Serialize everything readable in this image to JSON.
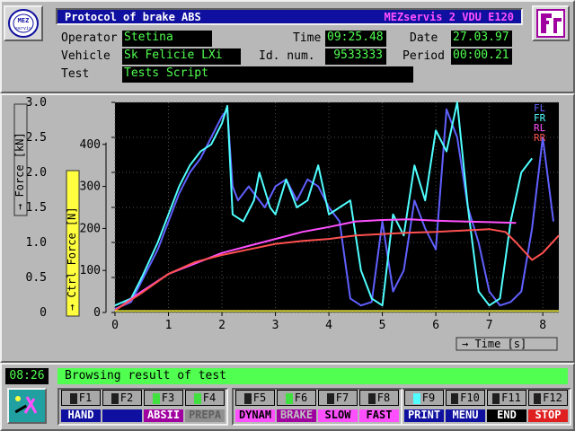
{
  "header": {
    "title": "Protocol of brake ABS",
    "brand": "MEZservis 2 VDU E120",
    "logo_text": "MEZ servis"
  },
  "form": {
    "operator_label": "Operator",
    "operator_value": "Stetina",
    "vehicle_label": "Vehicle",
    "vehicle_value": "Sk Felicie LXi",
    "test_label": "Test",
    "test_value": "Tests Script",
    "time_label": "Time",
    "time_value": "09:25.48",
    "idnum_label": "Id. num.",
    "idnum_value": "9533333",
    "date_label": "Date",
    "date_value": "27.03.97",
    "period_label": "Period",
    "period_value": "00:00.21"
  },
  "chart_data": {
    "type": "line",
    "ylabel": "Force [kN]",
    "ylabel2": "Ctrl Force [N]",
    "xlabel": "Time [s]",
    "xlim": [
      0,
      8.3
    ],
    "ylim": [
      0,
      3.0
    ],
    "y2lim": [
      0,
      500
    ],
    "x_ticks": [
      "0",
      "1",
      "2",
      "3",
      "4",
      "5",
      "6",
      "7",
      "8"
    ],
    "y_ticks": [
      "0",
      "0.5",
      "1.0",
      "1.5",
      "2.0",
      "2.5",
      "3.0"
    ],
    "y2_ticks": [
      "0",
      "100",
      "200",
      "300",
      "400"
    ],
    "grid": true,
    "legend_position": "top-right",
    "series": [
      {
        "name": "FL",
        "color": "#6060ff",
        "points": [
          [
            0,
            0.05
          ],
          [
            0.3,
            0.15
          ],
          [
            0.5,
            0.45
          ],
          [
            0.8,
            0.9
          ],
          [
            1.0,
            1.3
          ],
          [
            1.2,
            1.7
          ],
          [
            1.4,
            2.0
          ],
          [
            1.6,
            2.2
          ],
          [
            1.8,
            2.5
          ],
          [
            2.0,
            2.8
          ],
          [
            2.1,
            2.9
          ],
          [
            2.2,
            1.8
          ],
          [
            2.3,
            1.6
          ],
          [
            2.5,
            1.8
          ],
          [
            2.6,
            1.7
          ],
          [
            2.8,
            1.5
          ],
          [
            3.0,
            1.8
          ],
          [
            3.2,
            1.9
          ],
          [
            3.4,
            1.6
          ],
          [
            3.6,
            1.9
          ],
          [
            3.8,
            1.8
          ],
          [
            4.0,
            1.5
          ],
          [
            4.2,
            1.3
          ],
          [
            4.4,
            0.2
          ],
          [
            4.6,
            0.1
          ],
          [
            4.8,
            0.15
          ],
          [
            5.0,
            1.3
          ],
          [
            5.2,
            0.3
          ],
          [
            5.4,
            0.6
          ],
          [
            5.6,
            1.6
          ],
          [
            5.8,
            1.2
          ],
          [
            6.0,
            0.9
          ],
          [
            6.2,
            2.9
          ],
          [
            6.4,
            2.5
          ],
          [
            6.6,
            1.5
          ],
          [
            6.8,
            1.0
          ],
          [
            7.0,
            0.3
          ],
          [
            7.2,
            0.1
          ],
          [
            7.4,
            0.15
          ],
          [
            7.6,
            0.3
          ],
          [
            7.8,
            1.2
          ],
          [
            8.0,
            2.5
          ],
          [
            8.2,
            1.3
          ]
        ]
      },
      {
        "name": "FR",
        "color": "#50ffff",
        "points": [
          [
            0,
            0.1
          ],
          [
            0.3,
            0.2
          ],
          [
            0.5,
            0.5
          ],
          [
            0.8,
            1.0
          ],
          [
            1.0,
            1.4
          ],
          [
            1.2,
            1.8
          ],
          [
            1.4,
            2.1
          ],
          [
            1.6,
            2.3
          ],
          [
            1.8,
            2.4
          ],
          [
            2.0,
            2.7
          ],
          [
            2.1,
            2.95
          ],
          [
            2.2,
            1.4
          ],
          [
            2.4,
            1.3
          ],
          [
            2.6,
            1.6
          ],
          [
            2.7,
            2.0
          ],
          [
            2.9,
            1.5
          ],
          [
            3.0,
            1.4
          ],
          [
            3.2,
            1.9
          ],
          [
            3.4,
            1.5
          ],
          [
            3.6,
            1.6
          ],
          [
            3.8,
            2.1
          ],
          [
            4.0,
            1.4
          ],
          [
            4.2,
            1.5
          ],
          [
            4.4,
            1.6
          ],
          [
            4.6,
            0.6
          ],
          [
            4.8,
            0.2
          ],
          [
            5.0,
            0.1
          ],
          [
            5.2,
            1.4
          ],
          [
            5.4,
            1.1
          ],
          [
            5.6,
            2.1
          ],
          [
            5.8,
            1.6
          ],
          [
            6.0,
            2.6
          ],
          [
            6.2,
            2.3
          ],
          [
            6.4,
            3.0
          ],
          [
            6.6,
            1.5
          ],
          [
            6.8,
            0.3
          ],
          [
            7.0,
            0.1
          ],
          [
            7.2,
            0.2
          ],
          [
            7.4,
            1.3
          ],
          [
            7.6,
            2.0
          ],
          [
            7.8,
            2.2
          ]
        ]
      },
      {
        "name": "RL",
        "color": "#ff50ff",
        "points": [
          [
            0,
            0.03
          ],
          [
            0.5,
            0.3
          ],
          [
            1.0,
            0.55
          ],
          [
            1.5,
            0.7
          ],
          [
            2.0,
            0.85
          ],
          [
            2.5,
            0.95
          ],
          [
            3.0,
            1.05
          ],
          [
            3.5,
            1.15
          ],
          [
            4.0,
            1.22
          ],
          [
            4.5,
            1.3
          ],
          [
            5.0,
            1.32
          ],
          [
            5.5,
            1.33
          ],
          [
            6.0,
            1.31
          ],
          [
            6.5,
            1.3
          ],
          [
            7.0,
            1.29
          ],
          [
            7.5,
            1.28
          ]
        ]
      },
      {
        "name": "RR",
        "color": "#ff5050",
        "points": [
          [
            0,
            0.03
          ],
          [
            0.5,
            0.28
          ],
          [
            1.0,
            0.55
          ],
          [
            1.5,
            0.72
          ],
          [
            2.0,
            0.82
          ],
          [
            2.5,
            0.9
          ],
          [
            3.0,
            0.98
          ],
          [
            3.5,
            1.02
          ],
          [
            4.0,
            1.05
          ],
          [
            4.5,
            1.1
          ],
          [
            5.0,
            1.12
          ],
          [
            5.5,
            1.14
          ],
          [
            6.0,
            1.15
          ],
          [
            6.5,
            1.17
          ],
          [
            7.0,
            1.19
          ],
          [
            7.3,
            1.15
          ],
          [
            7.5,
            1.0
          ],
          [
            7.8,
            0.75
          ],
          [
            8.0,
            0.85
          ],
          [
            8.3,
            1.1
          ]
        ]
      },
      {
        "name": "",
        "color": "#e0e040",
        "points": [
          [
            0,
            0.02
          ],
          [
            8.3,
            0.02
          ]
        ]
      }
    ]
  },
  "status": {
    "clock": "08:26",
    "message": "Browsing result of test"
  },
  "fkeys": [
    {
      "key": "F1",
      "label": "HAND",
      "led": "#202020",
      "label_bg": "#1010a0",
      "label_fg": "#ffffff"
    },
    {
      "key": "F2",
      "label": "",
      "led": "#202020",
      "label_bg": "#1010a0",
      "label_fg": "#ffffff"
    },
    {
      "key": "F3",
      "label": "ABSII",
      "led": "#40e040",
      "label_bg": "#a000a0",
      "label_fg": "#ffffff"
    },
    {
      "key": "F4",
      "label": "PREPA",
      "led": "#40e040",
      "label_bg": "#909090",
      "label_fg": "#606060"
    },
    {
      "key": "F5",
      "label": "DYNAM",
      "led": "#202020",
      "label_bg": "#ff50ff",
      "label_fg": "#000000"
    },
    {
      "key": "F6",
      "label": "BRAKE",
      "led": "#40e040",
      "label_bg": "#a000a0",
      "label_fg": "#c0c0c0"
    },
    {
      "key": "F7",
      "label": "SLOW",
      "led": "#202020",
      "label_bg": "#ff50ff",
      "label_fg": "#000000"
    },
    {
      "key": "F8",
      "label": "FAST",
      "led": "#202020",
      "label_bg": "#ff50ff",
      "label_fg": "#000000"
    },
    {
      "key": "F9",
      "label": "PRINT",
      "led": "#50ffff",
      "label_bg": "#1010a0",
      "label_fg": "#ffffff"
    },
    {
      "key": "F10",
      "label": "MENU",
      "led": "#202020",
      "label_bg": "#1010a0",
      "label_fg": "#ffffff"
    },
    {
      "key": "F11",
      "label": "END",
      "led": "#202020",
      "label_bg": "#000000",
      "label_fg": "#ffffff"
    },
    {
      "key": "F12",
      "label": "STOP",
      "led": "#202020",
      "label_bg": "#e02020",
      "label_fg": "#ffffff"
    }
  ]
}
